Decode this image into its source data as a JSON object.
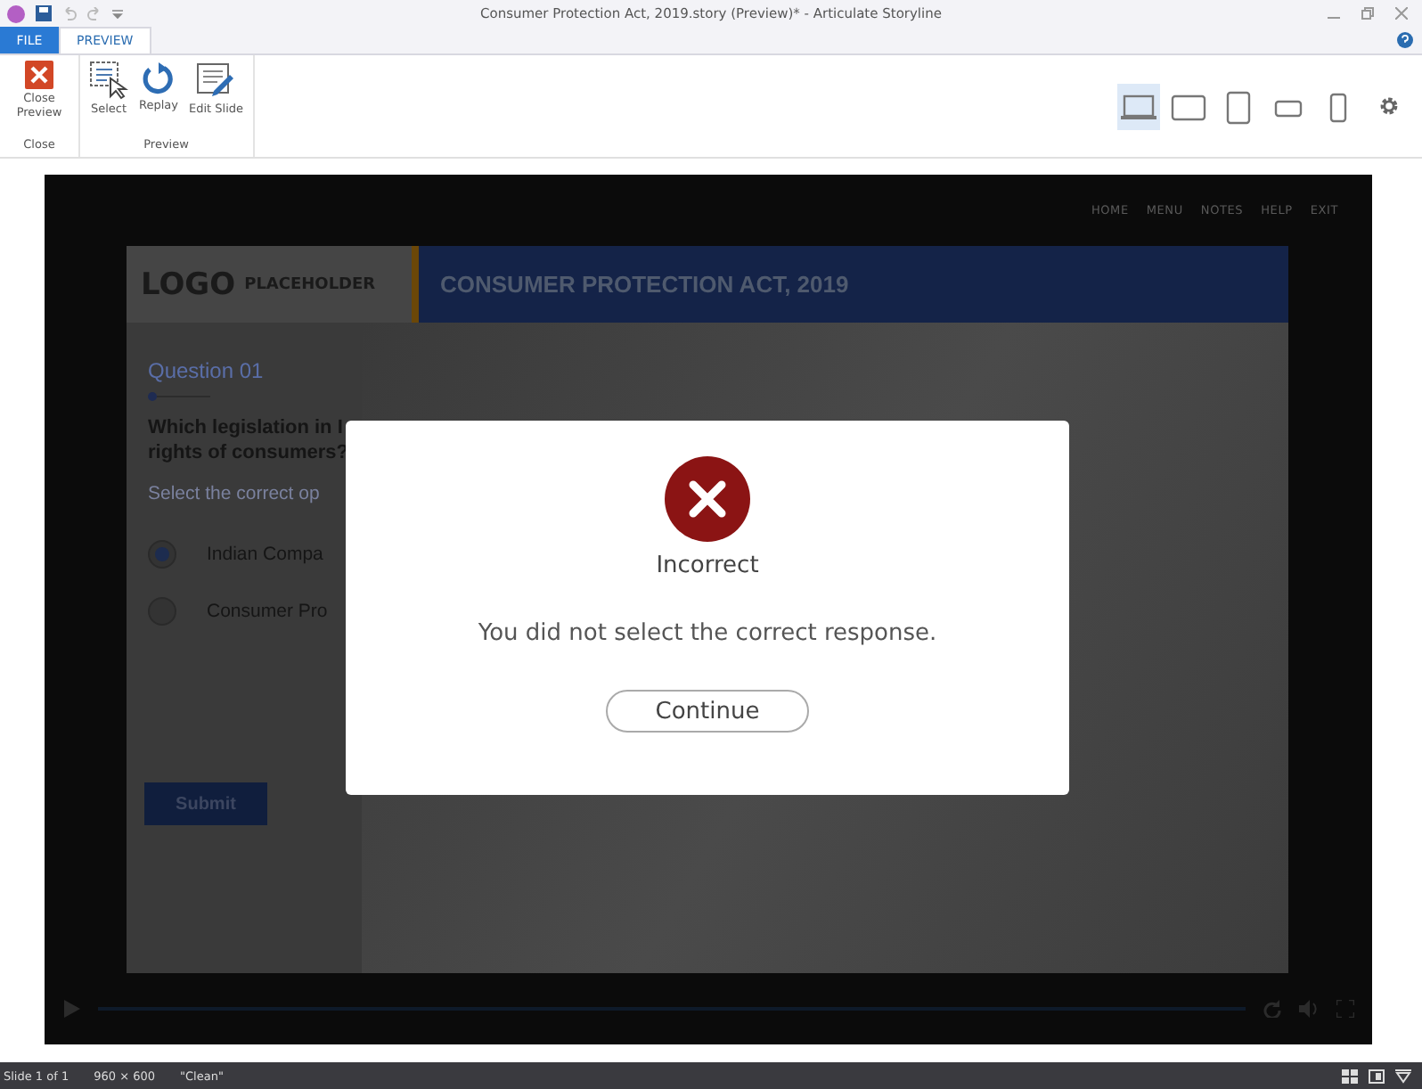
{
  "window": {
    "title": "Consumer Protection Act, 2019.story (Preview)* -  Articulate Storyline"
  },
  "tabs": [
    {
      "label": "FILE",
      "selected": false
    },
    {
      "label": "PREVIEW",
      "selected": true
    }
  ],
  "ribbon": {
    "groups": [
      {
        "label": "Close",
        "buttons": [
          {
            "label": "Close Preview",
            "kind": "close"
          }
        ]
      },
      {
        "label": "Preview",
        "buttons": [
          {
            "label": "Select",
            "kind": "select"
          },
          {
            "label": "Replay",
            "kind": "replay"
          },
          {
            "label": "Edit Slide",
            "kind": "edit"
          }
        ]
      }
    ],
    "devices": [
      {
        "kind": "laptop",
        "selected": true
      },
      {
        "kind": "tablet-landscape",
        "selected": false
      },
      {
        "kind": "tablet-portrait",
        "selected": false
      },
      {
        "kind": "phone-landscape",
        "selected": false
      },
      {
        "kind": "phone-portrait",
        "selected": false
      }
    ]
  },
  "player": {
    "nav": [
      "HOME",
      "MENU",
      "NOTES",
      "HELP",
      "EXIT"
    ],
    "slide": {
      "logo": "LOGO",
      "logo_sub": "PLACEHOLDER",
      "title": "CONSUMER PROTECTION ACT, 2019",
      "question_label": "Question 01",
      "question": [
        "Which legislation in I",
        "rights of consumers?"
      ],
      "instruction": "Select the correct op",
      "options": [
        {
          "label": "Indian Compa",
          "selected": true
        },
        {
          "label": "Consumer Pro",
          "selected": false
        }
      ],
      "submit": "Submit"
    },
    "dialog": {
      "title": "Incorrect",
      "message": "You did not select the correct response.",
      "button": "Continue"
    }
  },
  "status_bar": {
    "slide": "Slide 1 of 1",
    "size": "960 × 600",
    "theme": "\"Clean\""
  }
}
